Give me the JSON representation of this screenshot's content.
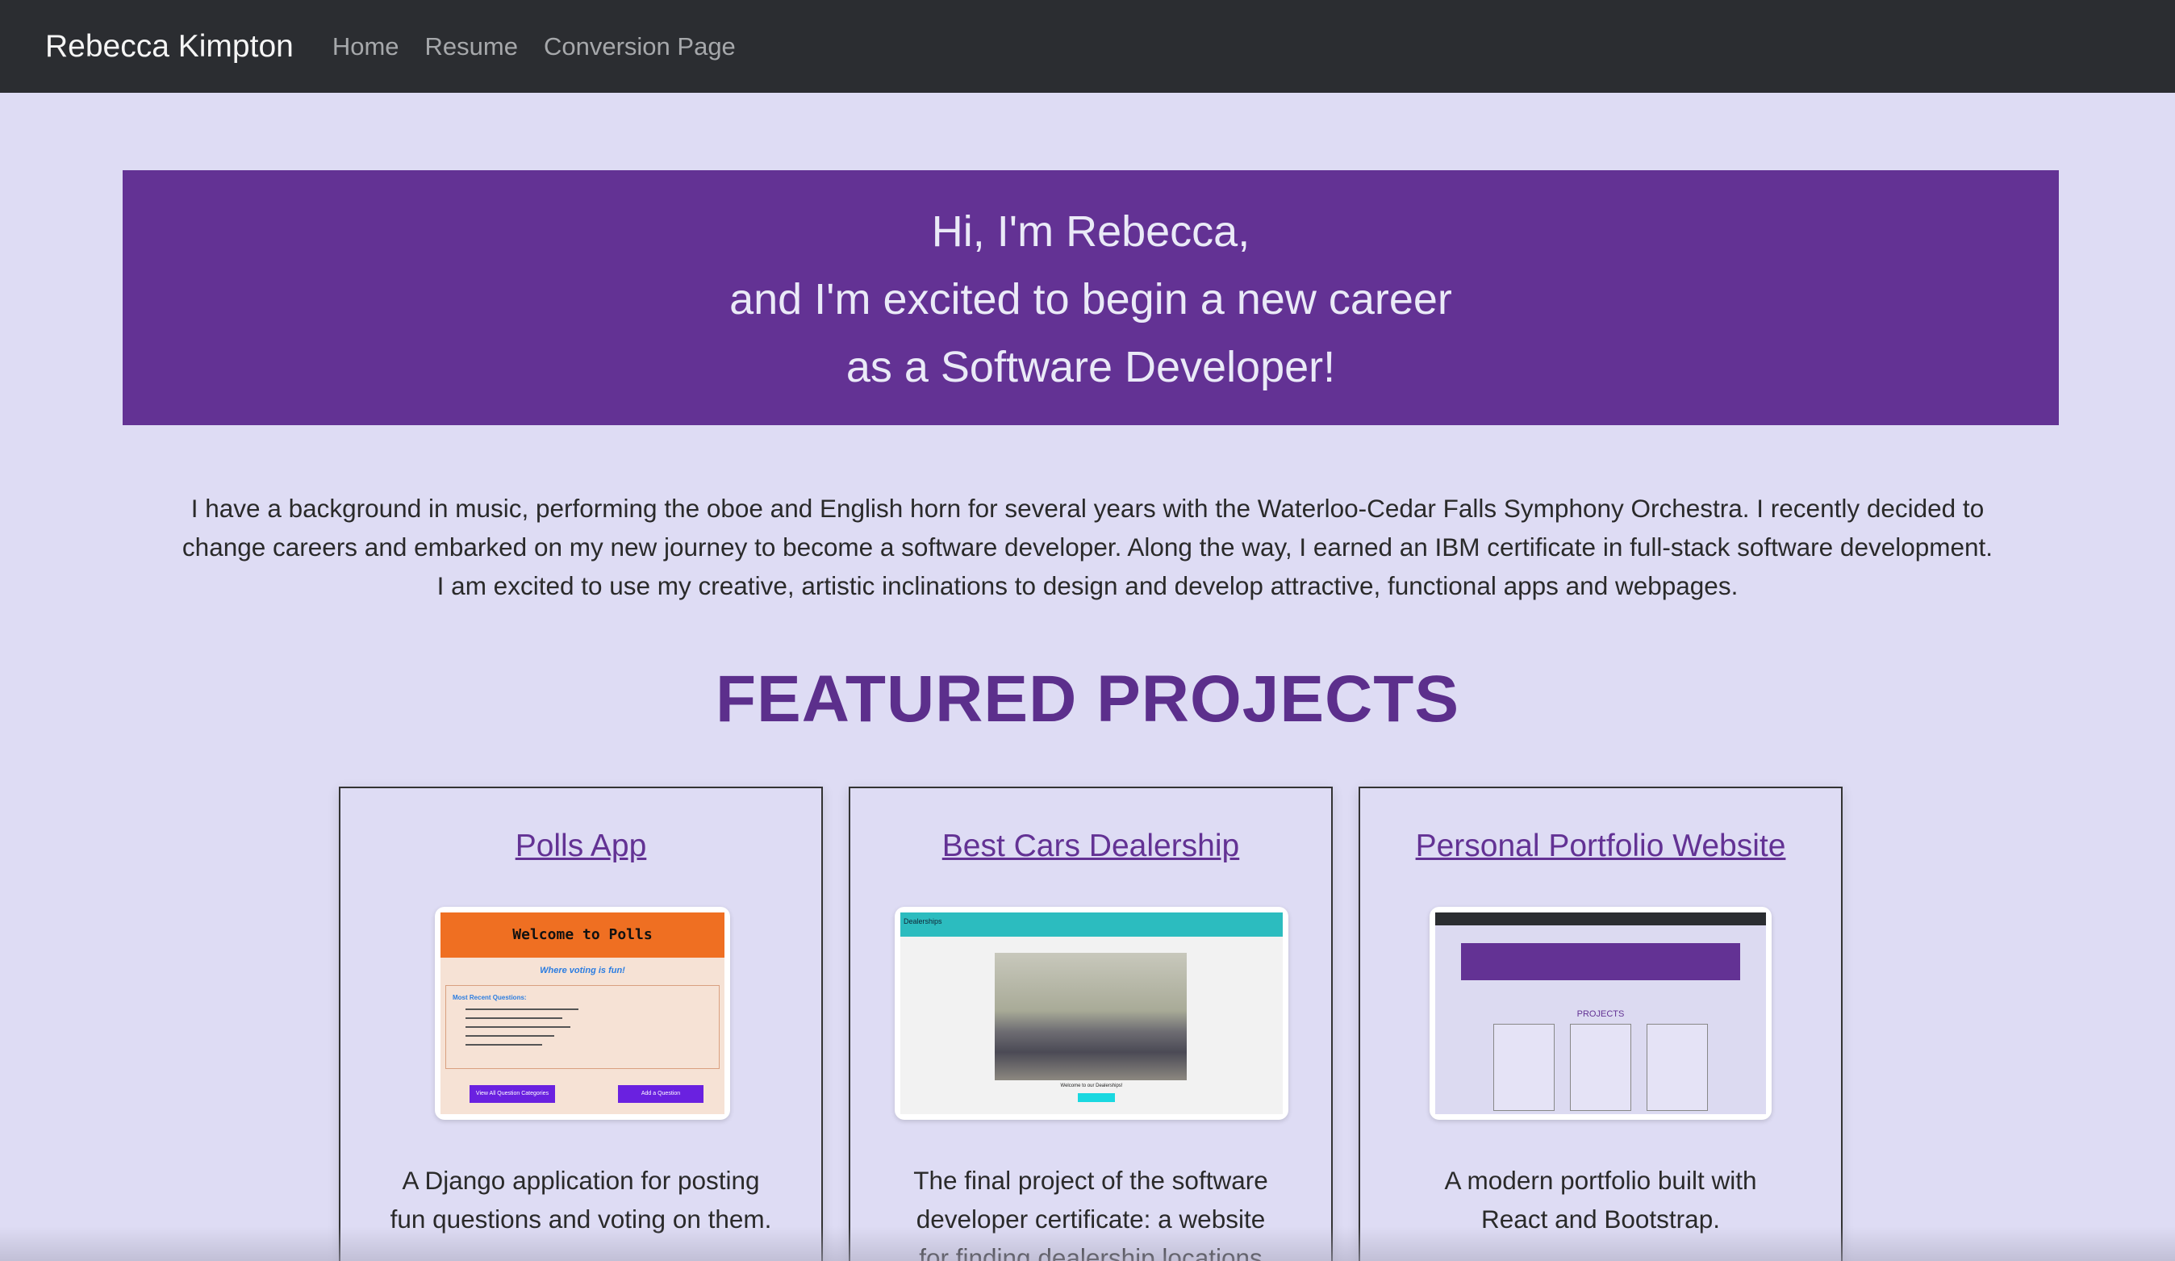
{
  "nav": {
    "brand": "Rebecca Kimpton",
    "links": [
      "Home",
      "Resume",
      "Conversion Page"
    ]
  },
  "hero": {
    "lines": [
      "Hi, I'm Rebecca,",
      "and I'm excited to begin a new career",
      "as a Software Developer!"
    ]
  },
  "intro": {
    "lines": [
      "I have a background in music, performing the oboe and English horn for several years with the Waterloo-Cedar Falls Symphony Orchestra. I recently decided to",
      "change careers and embarked on my new journey to become a software developer. Along the way, I earned an IBM certificate in full-stack software development.",
      "I am excited to use my creative, artistic inclinations to design and develop attractive, functional apps and webpages."
    ]
  },
  "projects": {
    "heading": "FEATURED PROJECTS",
    "items": [
      {
        "title": "Polls App",
        "desc_lines": [
          "A Django application for posting",
          "fun questions and voting on them."
        ],
        "thumb": {
          "header": "Welcome to Polls",
          "subtitle": "Where voting is fun!",
          "box_heading": "Most Recent Questions:",
          "btn1": "View All Question Categories",
          "btn2": "Add a Question"
        }
      },
      {
        "title": "Best Cars Dealership",
        "desc_lines": [
          "The final project of the software",
          "developer certificate: a website",
          "for finding dealership locations"
        ],
        "thumb": {
          "bar": "Dealerships",
          "caption": "Welcome to our Dealerships!"
        }
      },
      {
        "title": "Personal Portfolio Website",
        "desc_lines": [
          "A modern portfolio built with",
          "React and Bootstrap."
        ],
        "thumb": {
          "section": "PROJECTS"
        }
      }
    ]
  },
  "colors": {
    "background": "#dedcf4",
    "navbar": "#2b2d31",
    "hero": "#633294",
    "accent": "#5c2f8c"
  }
}
